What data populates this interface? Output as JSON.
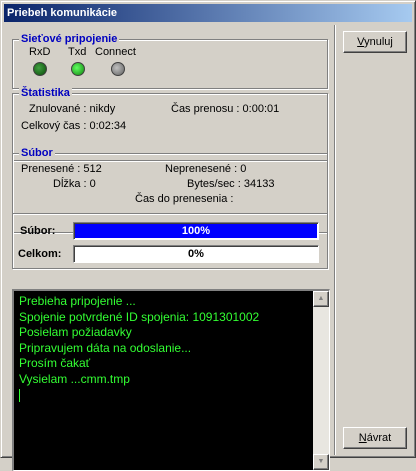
{
  "window": {
    "title": "Priebeh komunikácie"
  },
  "connection": {
    "title": "Sieťové pripojenie",
    "leds": [
      {
        "label": "RxD",
        "state": "dim"
      },
      {
        "label": "Txd",
        "state": "on"
      },
      {
        "label": "Connect",
        "state": "off"
      }
    ]
  },
  "stats": {
    "title": "Štatistika",
    "reset_label": "Znulované : nikdy",
    "transfer_time_label": "Čas prenosu : 0:00:01",
    "total_time_label": "Celkový čas : 0:02:34"
  },
  "file": {
    "title": "Súbor",
    "transferred_label": "Prenesené : 512",
    "not_transferred_label": "Neprenesené : 0",
    "length_label": "Dĺžka : 0",
    "rate_label": "Bytes/sec : 34133",
    "remaining_label": "Čas do prenesenia :"
  },
  "progress": {
    "file_label": "Súbor:",
    "file_percent": 100,
    "file_text": "100%",
    "total_label": "Celkom:",
    "total_percent": 0,
    "total_text": "0%"
  },
  "log": {
    "lines": [
      "Prebieha pripojenie ...",
      "Spojenie potvrdené ID spojenia: 1091301002",
      "Posielam požiadavky",
      "Pripravujem dáta na odoslanie...",
      "Prosím čakať",
      "Vysielam ...cmm.tmp"
    ]
  },
  "buttons": {
    "reset_prefix": "V",
    "reset_rest": "ynuluj",
    "back_prefix": "N",
    "back_rest": "ávrat"
  },
  "colors": {
    "title_start": "#0a246a",
    "title_end": "#a6caf0",
    "group_title": "#0000c0",
    "progress_fill": "#0000ff",
    "log_bg": "#000000",
    "log_text": "#33ff33"
  }
}
